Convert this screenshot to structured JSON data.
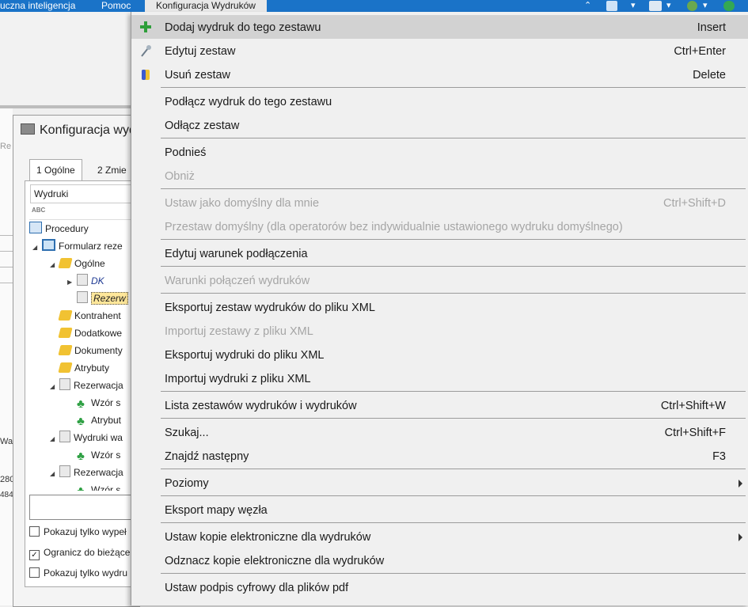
{
  "menubar": {
    "items": [
      "uczna inteligencja",
      "Pomoc",
      "Konfiguracja Wydruków"
    ]
  },
  "app": {
    "left_fragments": [
      "Re",
      "Wart",
      "280",
      "484"
    ]
  },
  "dialog": {
    "title": "Konfiguracja wyd",
    "tabs": [
      "1 Ogólne",
      "2 Zmie"
    ],
    "grid_header": "Wydruki",
    "abc_label": "ABC",
    "tree": [
      {
        "label": "Procedury"
      },
      {
        "label": "Formularz reze"
      },
      {
        "label": "Ogólne"
      },
      {
        "label": "DK"
      },
      {
        "label": "Rezerw"
      },
      {
        "label": "Kontrahent"
      },
      {
        "label": "Dodatkowe"
      },
      {
        "label": "Dokumenty"
      },
      {
        "label": "Atrybuty"
      },
      {
        "label": "Rezerwacja"
      },
      {
        "label": "Wzór s"
      },
      {
        "label": "Atrybut"
      },
      {
        "label": "Wydruki wa"
      },
      {
        "label": "Wzór s"
      },
      {
        "label": "Rezerwacja"
      },
      {
        "label": "Wzór s"
      }
    ],
    "checkboxes": [
      {
        "label": "Pokazuj tylko wypeł",
        "checked": false
      },
      {
        "label": "Ogranicz do bieżące",
        "checked": true
      },
      {
        "label": "Pokazuj tylko wydru",
        "checked": false
      }
    ]
  },
  "context_menu": {
    "items": [
      {
        "label": "Dodaj wydruk do tego zestawu",
        "shortcut": "Insert",
        "icon": "plus-icon"
      },
      {
        "label": "Edytuj zestaw",
        "shortcut": "Ctrl+Enter",
        "icon": "edit-icon"
      },
      {
        "label": "Usuń zestaw",
        "shortcut": "Delete",
        "icon": "delete-icon"
      },
      {
        "label": "Podłącz wydruk do tego zestawu",
        "shortcut": ""
      },
      {
        "label": "Odłącz zestaw",
        "shortcut": ""
      },
      {
        "label": "Podnieś",
        "shortcut": ""
      },
      {
        "label": "Obniż",
        "shortcut": ""
      },
      {
        "label": "Ustaw jako domyślny dla mnie",
        "shortcut": "Ctrl+Shift+D"
      },
      {
        "label": "Przestaw domyślny (dla operatorów bez indywidualnie ustawionego wydruku domyślnego)",
        "shortcut": ""
      },
      {
        "label": "Edytuj warunek podłączenia",
        "shortcut": ""
      },
      {
        "label": "Warunki połączeń wydruków",
        "shortcut": ""
      },
      {
        "label": "Eksportuj zestaw wydruków do pliku XML",
        "shortcut": ""
      },
      {
        "label": "Importuj zestawy z pliku XML",
        "shortcut": ""
      },
      {
        "label": "Eksportuj wydruki do pliku XML",
        "shortcut": ""
      },
      {
        "label": "Importuj wydruki z pliku XML",
        "shortcut": ""
      },
      {
        "label": "Lista zestawów wydruków i wydruków",
        "shortcut": "Ctrl+Shift+W"
      },
      {
        "label": "Szukaj...",
        "shortcut": "Ctrl+Shift+F"
      },
      {
        "label": "Znajdź następny",
        "shortcut": "F3"
      },
      {
        "label": "Poziomy",
        "shortcut": ""
      },
      {
        "label": "Eksport mapy węzła",
        "shortcut": ""
      },
      {
        "label": "Ustaw kopie elektroniczne dla wydruków",
        "shortcut": ""
      },
      {
        "label": "Odznacz kopie elektroniczne dla wydruków",
        "shortcut": ""
      },
      {
        "label": "Ustaw podpis cyfrowy dla plików pdf",
        "shortcut": ""
      }
    ]
  }
}
